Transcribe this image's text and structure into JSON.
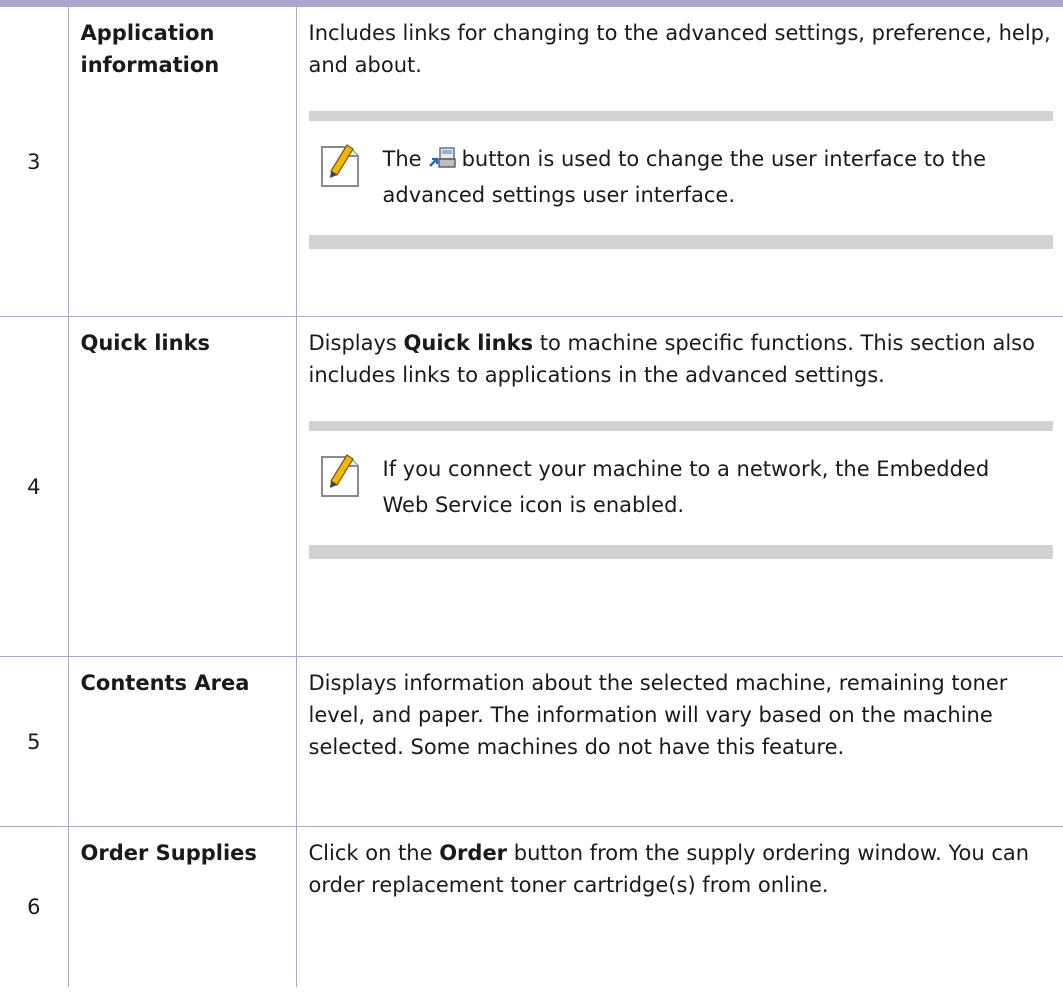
{
  "rows": [
    {
      "number": "3",
      "name_lines": [
        "Application",
        "information"
      ],
      "description": "Includes links for changing to the advanced settings, preference, help, and about.",
      "note": {
        "before": "The",
        "icon": "advanced-mode-switch-icon",
        "after": "button is used to change the user interface to the advanced settings user interface."
      }
    },
    {
      "number": "4",
      "name": "Quick links",
      "description": {
        "before": "Displays",
        "bold": "Quick links",
        "after": "to machine specific functions. This section also includes links to applications in the advanced settings."
      },
      "note": "If you connect your machine to a network, the Embedded Web Service icon is enabled."
    },
    {
      "number": "5",
      "name": "Contents Area",
      "description": "Displays information about the selected machine, remaining toner level, and paper. The information will vary based on the machine selected. Some machines do not have this feature."
    },
    {
      "number": "6",
      "name": "Order Supplies",
      "description": {
        "before": "Click on the",
        "bold": "Order",
        "after": "button from the supply ordering window. You can order replacement toner cartridge(s) from online."
      }
    }
  ],
  "colors": {
    "border": "#a8a8c8",
    "top_rule": "#a9a9cf",
    "note_band": "#d2d2d2",
    "pencil": "#f2b705"
  },
  "icons": [
    "note-pencil-icon",
    "advanced-mode-switch-icon"
  ]
}
